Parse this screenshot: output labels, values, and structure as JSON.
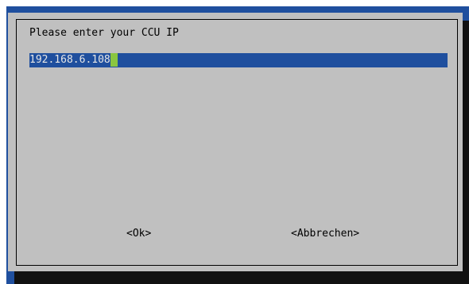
{
  "dialog": {
    "prompt": "Please enter your CCU IP",
    "input_value": "192.168.6.108",
    "ok_label": "<Ok>",
    "cancel_label": "<Abbrechen>"
  },
  "colors": {
    "terminal_background": "#1f4f9e",
    "dialog_background": "#c0c0c0",
    "input_background": "#1f4f9e",
    "input_text": "#e6e6e6",
    "cursor": "#8ac640",
    "shadow": "#111111"
  }
}
